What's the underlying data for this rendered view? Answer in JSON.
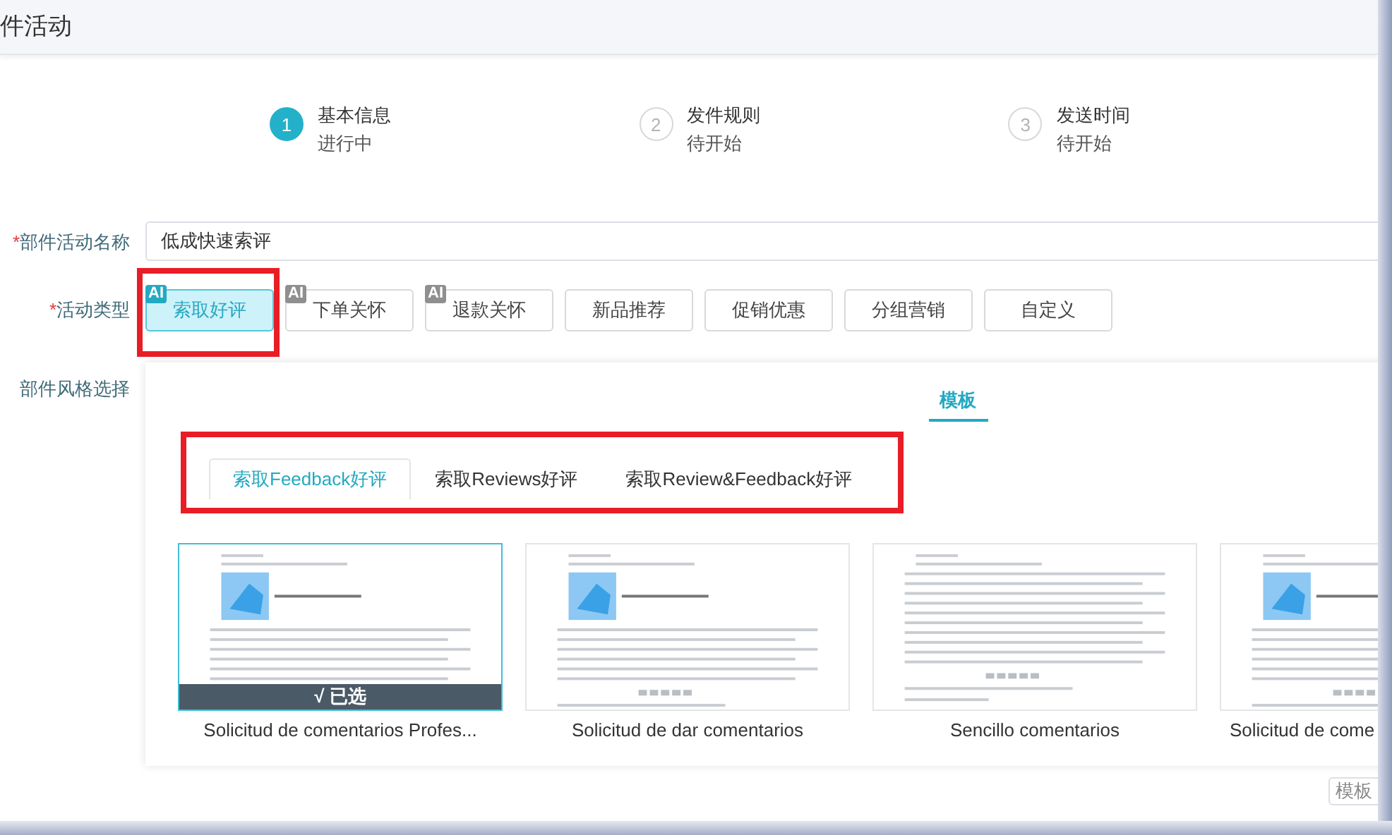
{
  "header": {
    "title": "件活动"
  },
  "steps": [
    {
      "number": "1",
      "title": "基本信息",
      "status": "进行中",
      "active": true
    },
    {
      "number": "2",
      "title": "发件规则",
      "status": "待开始",
      "active": false
    },
    {
      "number": "3",
      "title": "发送时间",
      "status": "待开始",
      "active": false
    }
  ],
  "form": {
    "name_field": {
      "marker": "*",
      "label": "部件活动名称",
      "value": "低成快速索评"
    },
    "type_field": {
      "marker": "*",
      "label": "活动类型",
      "options": [
        {
          "label": "索取好评",
          "badge": "AI",
          "selected": true
        },
        {
          "label": "下单关怀",
          "badge": "AI",
          "selected": false
        },
        {
          "label": "退款关怀",
          "badge": "AI",
          "selected": false
        },
        {
          "label": "新品推荐",
          "selected": false
        },
        {
          "label": "促销优惠",
          "selected": false
        },
        {
          "label": "分组营销",
          "selected": false
        },
        {
          "label": "自定义",
          "selected": false
        }
      ]
    },
    "style_field": {
      "label": "部件风格选择"
    }
  },
  "style_panel": {
    "tabs": [
      {
        "label": "模板",
        "selected": true
      }
    ],
    "subtabs": [
      {
        "label": "索取Feedback好评",
        "selected": true
      },
      {
        "label": "索取Reviews好评",
        "selected": false
      },
      {
        "label": "索取Review&Feedback好评",
        "selected": false
      }
    ],
    "selected_badge": "√ 已选",
    "templates": [
      {
        "kind": "picture",
        "caption": "Solicitud de comentarios Profes...",
        "selected": true
      },
      {
        "kind": "picture",
        "caption": "Solicitud de dar comentarios",
        "selected": false
      },
      {
        "kind": "picture",
        "caption": "Sencillo comentarios",
        "selected": false
      },
      {
        "kind": "picture",
        "caption": "Solicitud de come",
        "selected": false
      }
    ]
  },
  "footer_button": "模板"
}
